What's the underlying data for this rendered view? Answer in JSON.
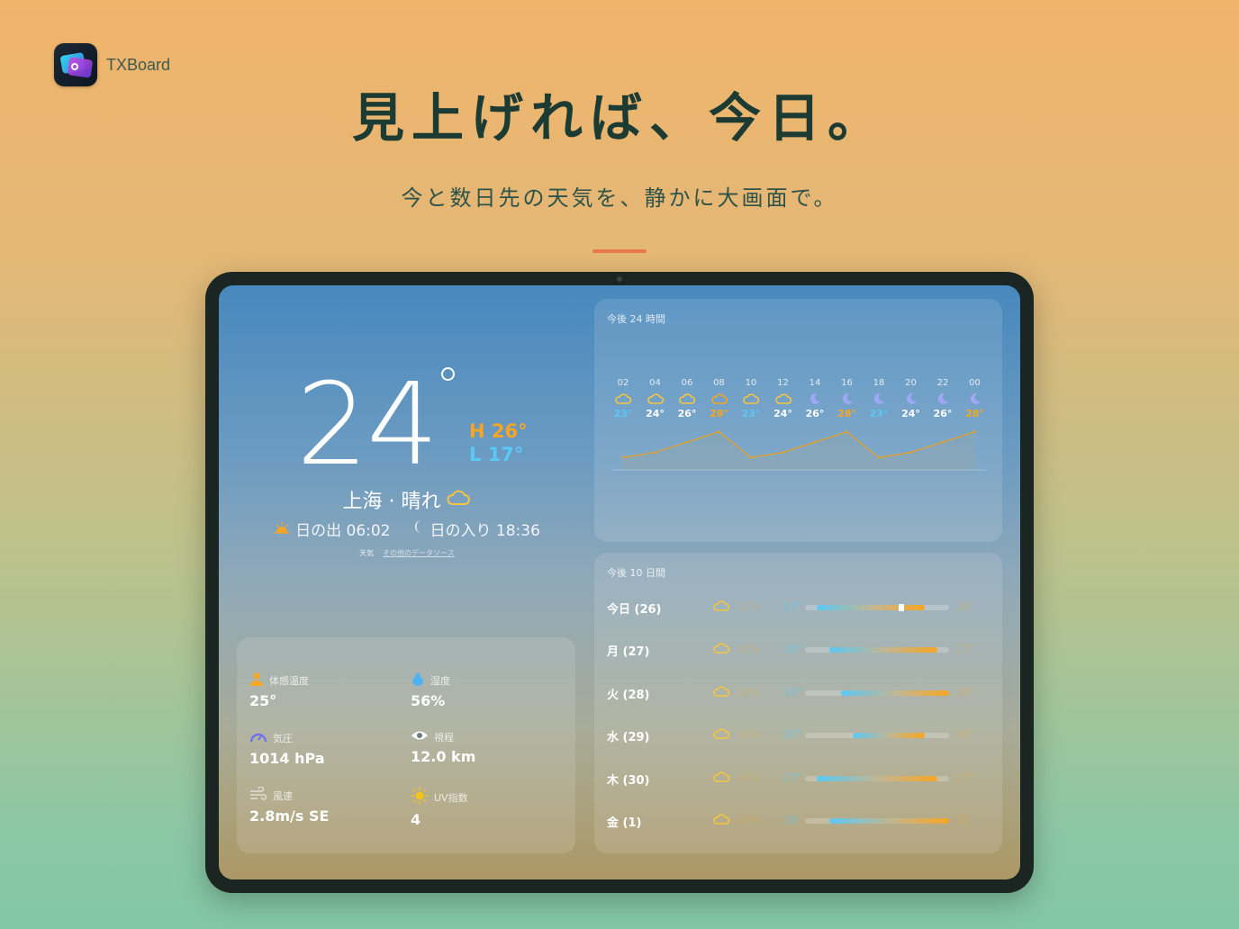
{
  "brand": {
    "name": "TXBoard"
  },
  "hero": {
    "headline": "見上げれば、今日。",
    "subline": "今と数日先の天気を、静かに大画面で。"
  },
  "current": {
    "temp": "24",
    "high": "H 26°",
    "low": "L 17°",
    "place": "上海 · 晴れ",
    "sunrise": "日の出 06:02",
    "sunset": "日の入り 18:36",
    "attribution_weather": " 天気",
    "attribution_link": "その他のデータソース"
  },
  "details": [
    {
      "label": "体感温度",
      "value": "25°",
      "icon": "person-icon"
    },
    {
      "label": "湿度",
      "value": "56%",
      "icon": "droplet-icon"
    },
    {
      "label": "気圧",
      "value": "1014 hPa",
      "icon": "gauge-icon"
    },
    {
      "label": "視程",
      "value": "12.0 km",
      "icon": "eye-icon"
    },
    {
      "label": "風速",
      "value": "2.8m/s SE",
      "icon": "wind-icon"
    },
    {
      "label": "UV指数",
      "value": "4",
      "icon": "sun-icon"
    }
  ],
  "hourly": {
    "title": "今後 24 時間",
    "hours": [
      {
        "h": "02",
        "temp": "23°",
        "icon": "cloud-icon",
        "t": 23
      },
      {
        "h": "04",
        "temp": "24°",
        "icon": "cloud-icon",
        "t": 24
      },
      {
        "h": "06",
        "temp": "26°",
        "icon": "cloud-icon",
        "t": 26
      },
      {
        "h": "08",
        "temp": "28°",
        "icon": "cloud-icon",
        "t": 28
      },
      {
        "h": "10",
        "temp": "23°",
        "icon": "cloud-icon",
        "t": 23
      },
      {
        "h": "12",
        "temp": "24°",
        "icon": "cloud-icon",
        "t": 24
      },
      {
        "h": "14",
        "temp": "26°",
        "icon": "moon-icon",
        "t": 26
      },
      {
        "h": "16",
        "temp": "28°",
        "icon": "moon-icon",
        "t": 28
      },
      {
        "h": "18",
        "temp": "23°",
        "icon": "moon-icon",
        "t": 23
      },
      {
        "h": "20",
        "temp": "24°",
        "icon": "moon-icon",
        "t": 24
      },
      {
        "h": "22",
        "temp": "26°",
        "icon": "moon-icon",
        "t": 26
      },
      {
        "h": "00",
        "temp": "28°",
        "icon": "moon-icon",
        "t": 28
      }
    ]
  },
  "daily": {
    "title": "今後 10 日間",
    "days": [
      {
        "name": "今日 (26)",
        "prob": "10%",
        "lo": "17°",
        "hi": "26°",
        "lo_v": 17,
        "hi_v": 26,
        "now_v": 24
      },
      {
        "name": "月 (27)",
        "prob": "10%",
        "lo": "18°",
        "hi": "27°",
        "lo_v": 18,
        "hi_v": 27
      },
      {
        "name": "火 (28)",
        "prob": "30%",
        "lo": "19°",
        "hi": "28°",
        "lo_v": 19,
        "hi_v": 28
      },
      {
        "name": "水 (29)",
        "prob": "10%",
        "lo": "20°",
        "hi": "26°",
        "lo_v": 20,
        "hi_v": 26
      },
      {
        "name": "木 (30)",
        "prob": "10%",
        "lo": "17°",
        "hi": "27°",
        "lo_v": 17,
        "hi_v": 27
      },
      {
        "name": "金 (1)",
        "prob": "10%",
        "lo": "18",
        "hi": "28",
        "lo_v": 18,
        "hi_v": 28
      }
    ],
    "range_min": 16,
    "range_max": 28
  },
  "colors": {
    "high": "#f5a623",
    "low": "#5cc8f5",
    "text_dark": "#1c3b33",
    "accent": "#e9774f"
  }
}
